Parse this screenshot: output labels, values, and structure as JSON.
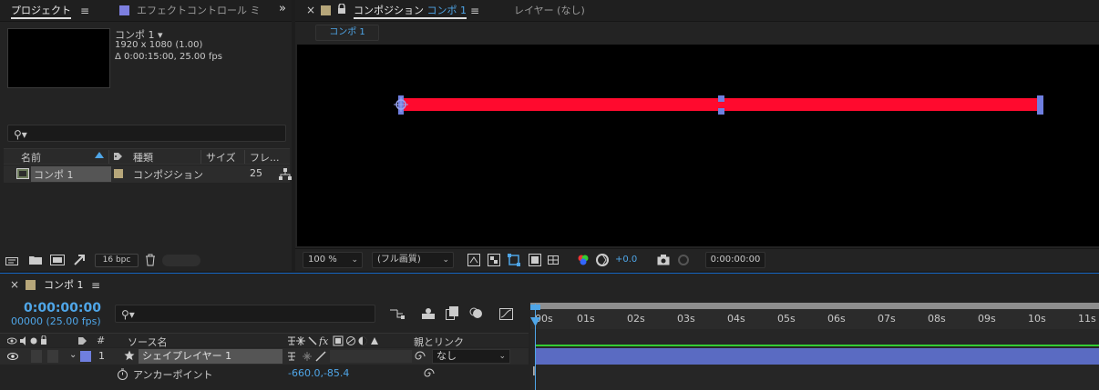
{
  "project_panel": {
    "tab_project": "プロジェクト",
    "tab_effect_controls": "エフェクトコントロール ミ",
    "more": "»",
    "comp_name": "コンポ 1 ▾",
    "resolution": "1920 x 1080 (1.00)",
    "duration": "Δ 0:00:15:00, 25.00 fps",
    "columns": [
      "名前",
      "種類",
      "サイズ",
      "フレ..."
    ],
    "items": [
      {
        "name": "コンポ 1",
        "type": "コンポジション",
        "size": "",
        "fps": "25"
      }
    ],
    "bpc": "16 bpc"
  },
  "comp_panel": {
    "close": "×",
    "tab_title": "コンポジション",
    "tab_comp": "コンポ 1",
    "tab_layer": "レイヤー (なし)",
    "breadcrumb": "コンポ 1",
    "zoom": "100 %",
    "quality": "(フル画質)",
    "exposure": "+0.0",
    "timecode": "0:00:00:00",
    "colors": {
      "shape_fill": "#ff0a2e",
      "handle": "#6f7fe0"
    }
  },
  "timeline": {
    "close": "×",
    "tab": "コンポ 1",
    "timecode": "0:00:00:00",
    "frames": "00000 (25.00 fps)",
    "ruler_ticks": [
      "00s",
      "01s",
      "02s",
      "03s",
      "04s",
      "05s",
      "06s",
      "07s",
      "08s",
      "09s",
      "10s",
      "11s"
    ],
    "col_hash": "#",
    "col_source": "ソース名",
    "col_parent": "親とリンク",
    "layer": {
      "index": "1",
      "name": "シェイプレイヤー 1",
      "parent": "なし"
    },
    "property": {
      "name": "アンカーポイント",
      "value": "-660.0,-85.4"
    },
    "cursor": "I",
    "colors": {
      "layer_bar": "#5a6bc2",
      "timecode": "#4fa6e8"
    }
  }
}
